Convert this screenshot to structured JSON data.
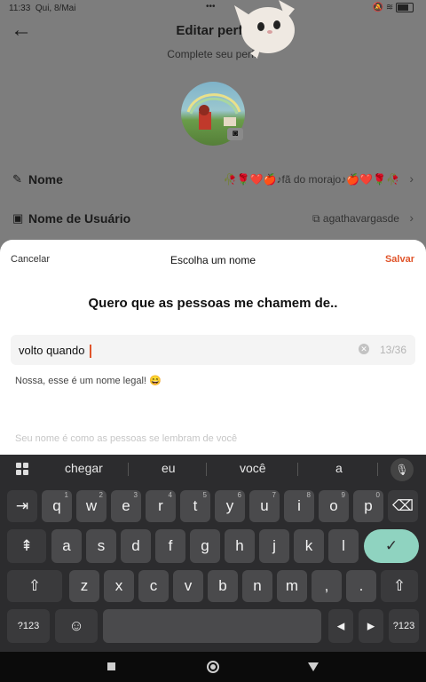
{
  "status": {
    "time": "11:33",
    "date": "Qui, 8/Mai",
    "dots": "•••"
  },
  "header": {
    "title": "Editar perfil",
    "subtitle": "Complete seu perfil"
  },
  "rows": [
    {
      "icon": "✎",
      "label": "Nome",
      "value": "🥀🌹❤️🍎♪fã do morajo♪🍎❤️🌹🥀"
    },
    {
      "icon": "▣",
      "label": "Nome de Usuário",
      "value": "⧉ agathavargasde"
    }
  ],
  "sheet": {
    "cancel": "Cancelar",
    "title": "Escolha um nome",
    "save": "Salvar",
    "heading": "Quero que as pessoas me chamem de..",
    "input_value": "volto quando ",
    "counter": "13/36",
    "hint": "Nossa, esse é um nome legal! 😄",
    "footer": "Seu nome é como as pessoas se lembram de você"
  },
  "keyboard": {
    "suggestions": [
      "chegar",
      "eu",
      "você",
      "a"
    ],
    "row1": [
      {
        "k": "⇥",
        "s": ""
      },
      {
        "k": "q",
        "s": "1"
      },
      {
        "k": "w",
        "s": "2"
      },
      {
        "k": "e",
        "s": "3"
      },
      {
        "k": "r",
        "s": "4"
      },
      {
        "k": "t",
        "s": "5"
      },
      {
        "k": "y",
        "s": "6"
      },
      {
        "k": "u",
        "s": "7"
      },
      {
        "k": "i",
        "s": "8"
      },
      {
        "k": "o",
        "s": "9"
      },
      {
        "k": "p",
        "s": "0"
      },
      {
        "k": "⌫",
        "s": ""
      }
    ],
    "row2": [
      "⇞",
      "a",
      "s",
      "d",
      "f",
      "g",
      "h",
      "j",
      "k",
      "l",
      "✓"
    ],
    "row3": [
      "⇧",
      "z",
      "x",
      "c",
      "v",
      "b",
      "n",
      "m",
      ",",
      ".",
      "⇧"
    ],
    "row4": [
      "?123",
      "☺",
      "",
      "◂",
      "▸",
      "?123"
    ]
  },
  "colors": {
    "accent": "#e0542a",
    "enter": "#8fd3c0"
  }
}
